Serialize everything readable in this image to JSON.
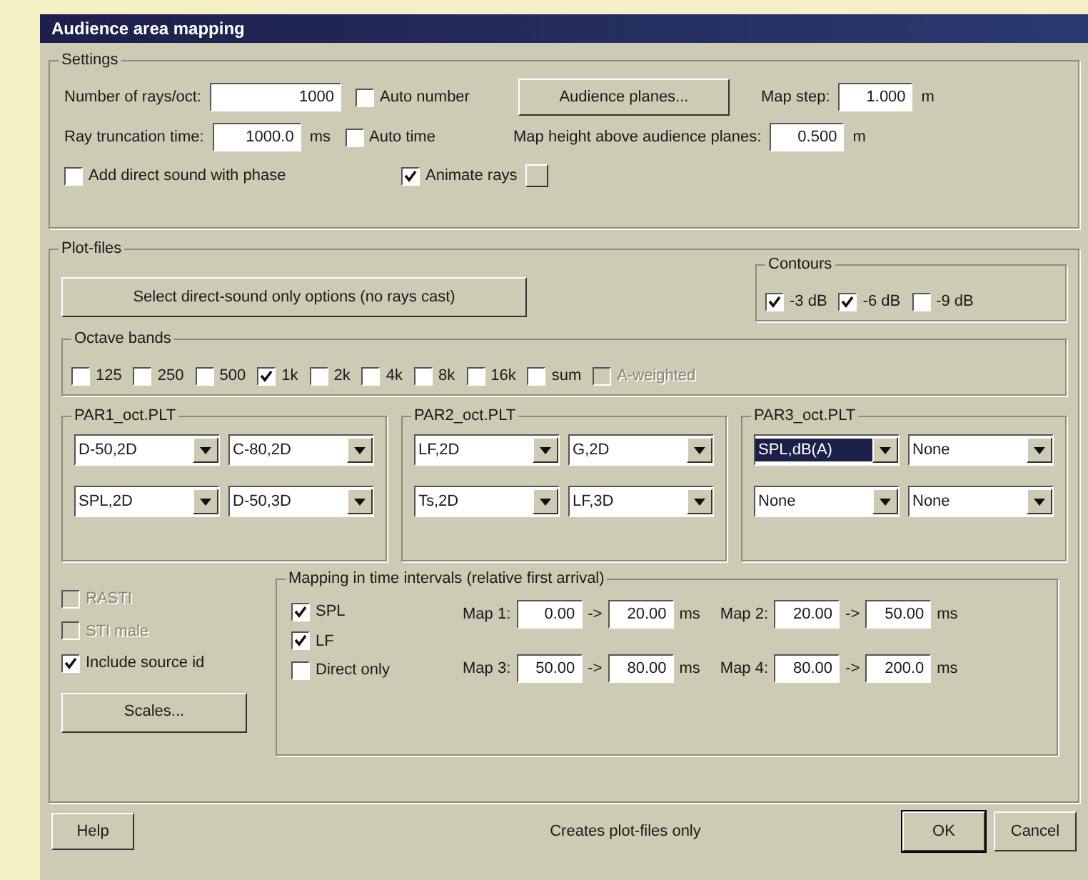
{
  "window": {
    "title": "Audience area mapping"
  },
  "settings": {
    "title": "Settings",
    "rays": {
      "label": "Number of rays/oct:",
      "value": "1000"
    },
    "auto_number": {
      "label": "Auto number",
      "checked": false
    },
    "audience_button": "Audience planes...",
    "map_step": {
      "label": "Map step:",
      "value": "1.000",
      "unit": "m"
    },
    "truncation": {
      "label": "Ray truncation time:",
      "value": "1000.0",
      "unit": "ms"
    },
    "auto_time": {
      "label": "Auto time",
      "checked": false
    },
    "map_height": {
      "label": "Map height above audience planes:",
      "value": "0.500",
      "unit": "m"
    },
    "direct_sound": {
      "label": "Add direct sound with phase",
      "checked": false
    },
    "animate_rays": {
      "label": "Animate rays",
      "checked": true
    }
  },
  "plot_files": {
    "title": "Plot-files",
    "direct_button": "Select direct-sound only options (no rays cast)",
    "contours": {
      "title": "Contours",
      "items": [
        {
          "label": "-3 dB",
          "checked": true
        },
        {
          "label": "-6 dB",
          "checked": true
        },
        {
          "label": "-9 dB",
          "checked": false
        }
      ]
    },
    "octave_bands": {
      "title": "Octave bands",
      "items": [
        {
          "label": "125",
          "checked": false,
          "disabled": false
        },
        {
          "label": "250",
          "checked": false,
          "disabled": false
        },
        {
          "label": "500",
          "checked": false,
          "disabled": false
        },
        {
          "label": "1k",
          "checked": true,
          "disabled": false
        },
        {
          "label": "2k",
          "checked": false,
          "disabled": false
        },
        {
          "label": "4k",
          "checked": false,
          "disabled": false
        },
        {
          "label": "8k",
          "checked": false,
          "disabled": false
        },
        {
          "label": "16k",
          "checked": false,
          "disabled": false
        },
        {
          "label": "sum",
          "checked": false,
          "disabled": false
        },
        {
          "label": "A-weighted",
          "checked": false,
          "disabled": true
        }
      ]
    },
    "par_groups": [
      {
        "title": "PAR1_oct.PLT",
        "combos": [
          {
            "value": "D-50,2D",
            "selected": false
          },
          {
            "value": "C-80,2D",
            "selected": false
          },
          {
            "value": "SPL,2D",
            "selected": false
          },
          {
            "value": "D-50,3D",
            "selected": false
          }
        ]
      },
      {
        "title": "PAR2_oct.PLT",
        "combos": [
          {
            "value": "LF,2D",
            "selected": false
          },
          {
            "value": "G,2D",
            "selected": false
          },
          {
            "value": "Ts,2D",
            "selected": false
          },
          {
            "value": "LF,3D",
            "selected": false
          }
        ]
      },
      {
        "title": "PAR3_oct.PLT",
        "combos": [
          {
            "value": "SPL,dB(A)",
            "selected": true
          },
          {
            "value": "None",
            "selected": false
          },
          {
            "value": "None",
            "selected": false
          },
          {
            "value": "None",
            "selected": false
          }
        ]
      }
    ],
    "options": [
      {
        "label": "RASTI",
        "checked": false,
        "disabled": true
      },
      {
        "label": "STI male",
        "checked": false,
        "disabled": true
      },
      {
        "label": "Include source id",
        "checked": true,
        "disabled": false
      }
    ],
    "scales_button": "Scales...",
    "mapping": {
      "title": "Mapping in time intervals (relative first arrival)",
      "quantities": [
        {
          "label": "SPL",
          "checked": true
        },
        {
          "label": "LF",
          "checked": true
        },
        {
          "label": "Direct only",
          "checked": false
        }
      ],
      "maps": [
        {
          "label": "Map 1:",
          "from": "0.00",
          "arrow": "->",
          "to": "20.00",
          "unit": "ms"
        },
        {
          "label": "Map 2:",
          "from": "20.00",
          "arrow": "->",
          "to": "50.00",
          "unit": "ms"
        },
        {
          "label": "Map 3:",
          "from": "50.00",
          "arrow": "->",
          "to": "80.00",
          "unit": "ms"
        },
        {
          "label": "Map 4:",
          "from": "80.00",
          "arrow": "->",
          "to": "200.0",
          "unit": "ms"
        }
      ]
    }
  },
  "footer": {
    "help": "Help",
    "status": "Creates plot-files only",
    "ok": "OK",
    "cancel": "Cancel"
  }
}
